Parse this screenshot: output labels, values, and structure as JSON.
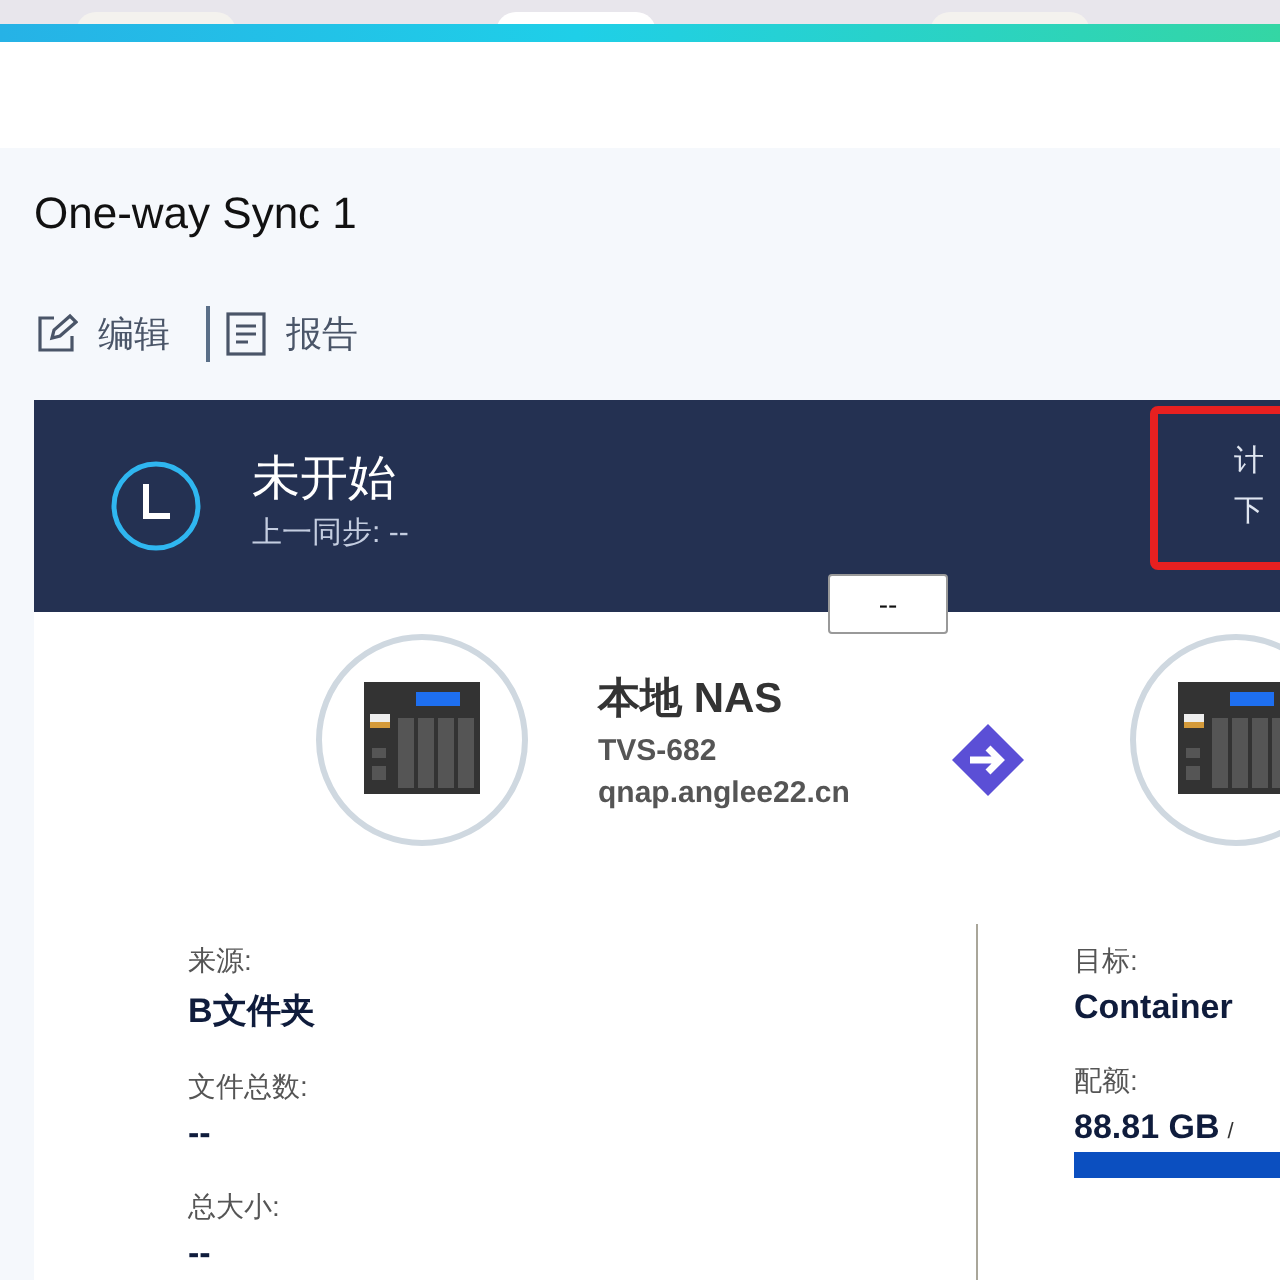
{
  "page": {
    "title": "One-way Sync 1"
  },
  "toolbar": [
    {
      "kind": "edit",
      "label": "编辑"
    },
    {
      "kind": "report",
      "label": "报告"
    }
  ],
  "status": {
    "title": "未开始",
    "last_sync": "上一同步: --",
    "schedule_label": "计",
    "next_label": "下",
    "progress_button": "--"
  },
  "source": {
    "name": "本地 NAS",
    "model": "TVS-682",
    "host": "qnap.anglee22.cn"
  },
  "details_left": [
    {
      "label": "来源:",
      "value": "B文件夹"
    },
    {
      "label": "文件总数:",
      "value": "--"
    },
    {
      "label": "总大小:",
      "value": "--"
    }
  ],
  "details_right": {
    "target_label": "目标:",
    "target": "Container",
    "quota_label": "配额:",
    "quota": "88.81 GB",
    "quota_sep": "/"
  }
}
